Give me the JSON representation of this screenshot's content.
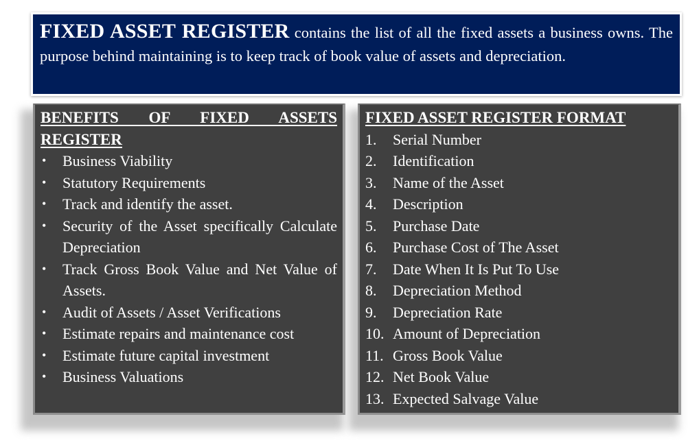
{
  "intro": {
    "title": "FIXED ASSET REGISTER",
    "text": " contains the list of all the fixed assets a business owns. The purpose behind maintaining is to keep track of book value of assets and depreciation."
  },
  "benefits": {
    "heading": "BENEFITS OF FIXED ASSETS REGISTER",
    "bullet_glyph": "•",
    "items": [
      "Business Viability",
      "Statutory Requirements",
      "Track and identify the asset.",
      "Security of the Asset specifically Calculate Depreciation",
      "Track Gross Book Value and Net Value of Assets.",
      "Audit of Assets / Asset Verifications",
      "Estimate repairs and maintenance cost",
      "Estimate future capital investment",
      "Business Valuations"
    ]
  },
  "format": {
    "heading": "FIXED ASSET REGISTER FORMAT",
    "items": [
      {
        "num": "1.",
        "label": "Serial Number"
      },
      {
        "num": "2.",
        "label": "Identification"
      },
      {
        "num": "3.",
        "label": "Name of the Asset"
      },
      {
        "num": "4.",
        "label": "Description"
      },
      {
        "num": "5.",
        "label": "Purchase Date"
      },
      {
        "num": "6.",
        "label": "Purchase Cost of The Asset"
      },
      {
        "num": "7.",
        "label": "Date When It Is Put To Use"
      },
      {
        "num": "8.",
        "label": "Depreciation Method"
      },
      {
        "num": "9.",
        "label": "Depreciation Rate"
      },
      {
        "num": "10.",
        "label": "Amount of Depreciation"
      },
      {
        "num": "11.",
        "label": "Gross Book Value"
      },
      {
        "num": "12.",
        "label": "Net Book Value"
      },
      {
        "num": "13.",
        "label": "Expected Salvage Value"
      }
    ]
  },
  "colors": {
    "intro_background": "#001d59",
    "panel_background": "#404040",
    "text": "#ffffff"
  }
}
